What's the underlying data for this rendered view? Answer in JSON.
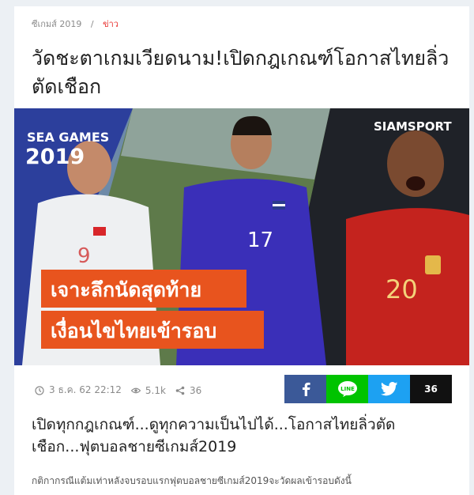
{
  "breadcrumb": {
    "section": "ซีเกมส์ 2019",
    "separator": "/",
    "current": "ข่าว"
  },
  "article": {
    "title": "วัดชะตาเกมเวียดนาม!เปิดกฎเกณฑ์โอกาสไทยลิ่วตัดเชือก",
    "lead": "เปิดทุกกฎเกณฑ์...ดูทุกความเป็นไปได้...โอกาสไทยลิ่วตัดเชือก...ฟุตบอลชายซีเกมส์2019",
    "body": "กติกากรณีแต้มเท่าหลังจบรอบแรกฟุตบอลชายซีเกมส์2019จะวัดผลเข้ารอบดังนี้"
  },
  "hero": {
    "logo_line1": "SEA GAMES",
    "logo_line2": "2019",
    "brand": "SIAMSPORT",
    "banner_line1": "เจาะลึกนัดสุดท้าย",
    "banner_line2": "เงื่อนไขไทยเข้ารอบ",
    "jersey_left": "9",
    "jersey_center": "17",
    "jersey_right": "20"
  },
  "meta": {
    "date": "3 ธ.ค. 62  22:12",
    "views": "5.1k",
    "shares": "36"
  },
  "share": {
    "count": "36",
    "line_label": "LINE"
  },
  "colors": {
    "accent": "#e8322f",
    "facebook": "#3b5998",
    "line": "#00c300",
    "twitter": "#1da1f2"
  }
}
